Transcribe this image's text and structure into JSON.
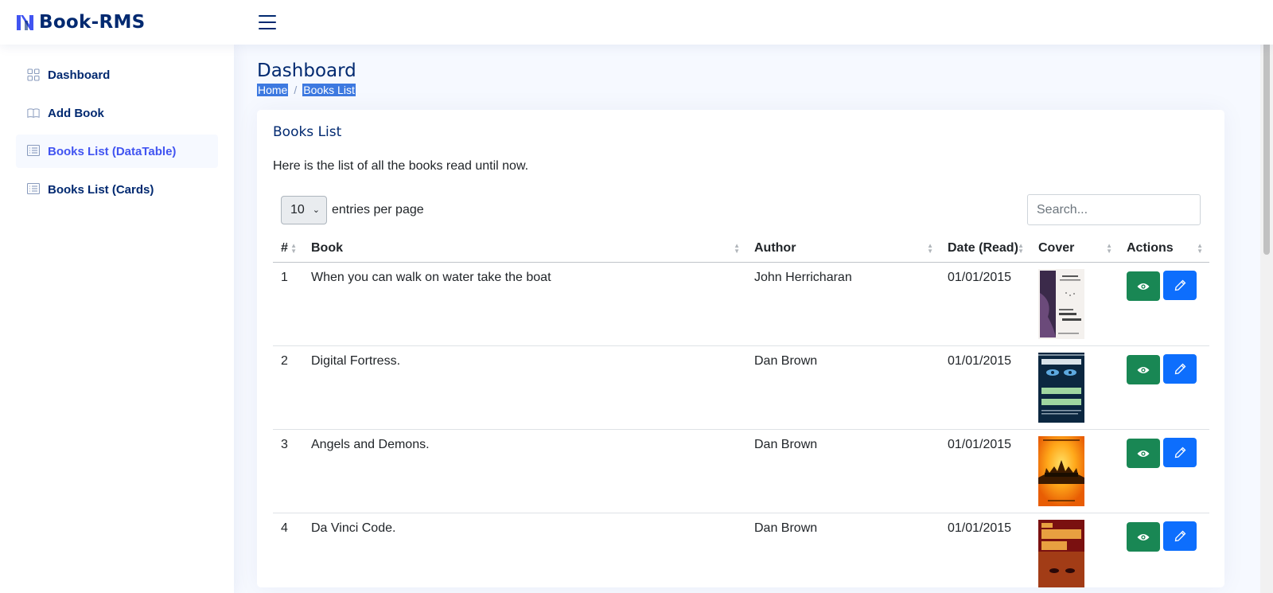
{
  "app": {
    "name": "Book-RMS"
  },
  "sidebar": {
    "items": [
      {
        "label": "Dashboard",
        "icon": "grid-icon"
      },
      {
        "label": "Add Book",
        "icon": "book-icon"
      },
      {
        "label": "Books List (DataTable)",
        "icon": "list-icon",
        "active": true
      },
      {
        "label": "Books List (Cards)",
        "icon": "list-icon"
      }
    ]
  },
  "page": {
    "title": "Dashboard",
    "breadcrumb": [
      "Home",
      "Books List"
    ]
  },
  "card": {
    "title": "Books List",
    "description": "Here is the list of all the books read until now."
  },
  "table_controls": {
    "per_page_value": "10",
    "per_page_label": "entries per page",
    "search_placeholder": "Search..."
  },
  "table": {
    "headers": [
      "#",
      "Book",
      "Author",
      "Date (Read)",
      "Cover",
      "Actions"
    ],
    "rows": [
      {
        "num": "1",
        "book": "When you can walk on water take the boat",
        "author": "John Herricharan",
        "date": "01/01/2015",
        "cover_text": "When You Can Walk On Water Take The Boat"
      },
      {
        "num": "2",
        "book": "Digital Fortress.",
        "author": "Dan Brown",
        "date": "01/01/2015",
        "cover_text": "DAN BROWN DIGITAL FORTRESS"
      },
      {
        "num": "3",
        "book": "Angels and Demons.",
        "author": "Dan Brown",
        "date": "01/01/2015",
        "cover_text": "Angels & Demons"
      },
      {
        "num": "4",
        "book": "Da Vinci Code.",
        "author": "Dan Brown",
        "date": "01/01/2015",
        "cover_text": "THE DA VINCI CODE"
      }
    ]
  },
  "colors": {
    "brand": "#012970",
    "accent": "#4154f1",
    "view_button": "#198754",
    "edit_button": "#0d6efd"
  }
}
